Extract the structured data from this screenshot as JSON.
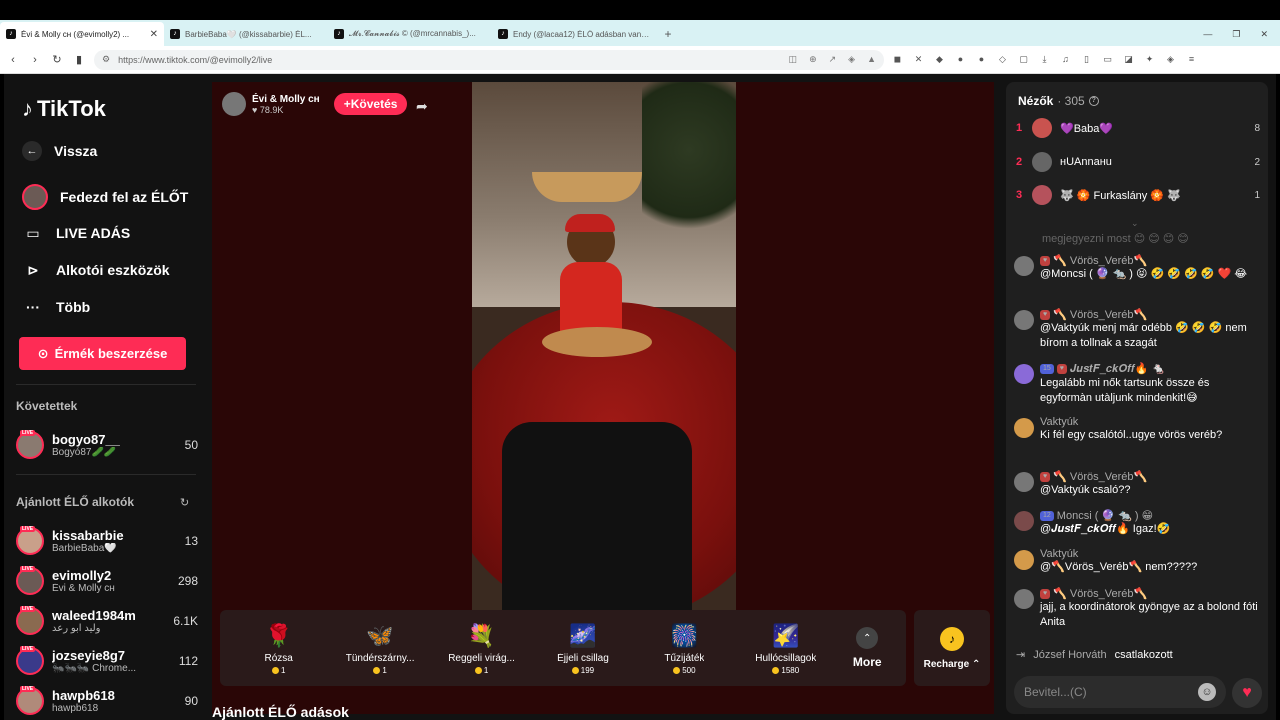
{
  "browser": {
    "tabs": [
      {
        "title": "Évi & Molly ᴄʜ (@evimolly2) ..."
      },
      {
        "title": "BarbieBaba🤍 (@kissabarbie) ÉL..."
      },
      {
        "title": "𝓜𝓻.𝓒𝓪𝓷𝓷𝓪𝓫𝓲𝓼 © (@mrcannabis_)..."
      },
      {
        "title": "Endy (@lacaa12) ÉLŐ adásban van – ..."
      }
    ],
    "url": "https://www.tiktok.com/@evimolly2/live"
  },
  "sidebar": {
    "logo": "TikTok",
    "back": "Vissza",
    "nav": [
      {
        "label": "Fedezd fel az ÉLŐT"
      },
      {
        "label": "LIVE ADÁS"
      },
      {
        "label": "Alkotói eszközök"
      },
      {
        "label": "Több"
      }
    ],
    "coins_button": "Érmék beszerzése",
    "following_title": "Követettek",
    "following": [
      {
        "user": "bogyo87__",
        "name": "Bogyó87🥒🥒",
        "count": "50"
      }
    ],
    "suggested_title": "Ajánlott ÉLŐ alkotók",
    "suggested": [
      {
        "user": "kissabarbie",
        "name": "BarbieBaba🤍",
        "count": "13"
      },
      {
        "user": "evimolly2",
        "name": "Évi & Molly ᴄʜ",
        "count": "298"
      },
      {
        "user": "waleed1984m",
        "name": "وليد ابو رعد",
        "count": "6.1K"
      },
      {
        "user": "jozseyie8g7",
        "name": "🐜🐜🐜 Chrome...",
        "count": "112"
      },
      {
        "user": "hawpb618",
        "name": "hawpb618",
        "count": "90"
      }
    ],
    "live_badge": "LIVE"
  },
  "stream": {
    "name": "Évi & Molly ᴄʜ",
    "likes": "78.9K",
    "follow": "+Követés"
  },
  "gifts": [
    {
      "name": "Rózsa",
      "price": "1",
      "icon": "🌹"
    },
    {
      "name": "Tündérszárny...",
      "price": "1",
      "icon": "🦋"
    },
    {
      "name": "Reggeli virág...",
      "price": "1",
      "icon": "💐"
    },
    {
      "name": "Éjjeli csillag",
      "price": "199",
      "icon": "🌌"
    },
    {
      "name": "Tűzijáték",
      "price": "500",
      "icon": "🎆"
    },
    {
      "name": "Hullócsillagok",
      "price": "1580",
      "icon": "🌠"
    }
  ],
  "more_label": "More",
  "recharge_label": "Recharge ⌃",
  "section_heading": "Ajánlott ÉLŐ adások",
  "panel": {
    "viewers_label": "Nézők",
    "viewers_count": "· 305",
    "ranking": [
      {
        "rank": "1",
        "name": "💜Baba💜",
        "score": "8",
        "color": "#c9534f"
      },
      {
        "rank": "2",
        "name": "нUAnnaнu",
        "score": "2",
        "color": "#666"
      },
      {
        "rank": "3",
        "name": "🐺 🏵️ Furkaslány 🏵️ 🐺",
        "score": "1",
        "color": "#b5525c"
      }
    ],
    "faded_text": "megjegyezni most 😊 😊 😊 😊",
    "messages": [
      {
        "user": "🪓 Vörös_Veréb🪓",
        "badges": [
          "♥"
        ],
        "text": "@Moncsi ( 🔮 🐀 ) 😝 🤣 🤣 🤣 🤣 ❤️ 😂",
        "avatar": "#777"
      },
      {
        "user": "🪓 Vörös_Veréb🪓",
        "badges": [
          "♥"
        ],
        "text": "@Vaktyúk menj már odébb 🤣 🤣 🤣 nem bírom a tollnak a szagát",
        "avatar": "#777"
      },
      {
        "user": "𝑱𝒖𝒔𝒕𝑭_𝒄𝒌𝑶𝒇𝒇🔥 🐁",
        "badges": [
          "15",
          "♥"
        ],
        "text": "Legalább mi nők tartsunk össze és egyformàn utàljunk mindenkit!😅",
        "avatar": "#8a6ad8"
      },
      {
        "user": "Vaktyúk",
        "badges": [],
        "text": "Ki fél egy csalótól..ugye vörös veréb?",
        "avatar": "#d49a4a"
      },
      {
        "user": "🪓 Vörös_Veréb🪓",
        "badges": [
          "♥"
        ],
        "text": "@Vaktyúk csaló??",
        "avatar": "#777"
      },
      {
        "user": "Moncsi ( 🔮 🐀 ) 😁",
        "badges": [
          "12"
        ],
        "text": "@𝑱𝒖𝒔𝒕𝑭_𝒄𝒌𝑶𝒇𝒇🔥 Igaz!🤣",
        "avatar": "#7a4a4a"
      },
      {
        "user": "Vaktyúk",
        "badges": [],
        "text": "@🪓Vörös_Veréb🪓 nem?????",
        "avatar": "#d49a4a"
      },
      {
        "user": "🪓 Vörös_Veréb🪓",
        "badges": [
          "♥"
        ],
        "text": "jajj, a koordinátorok gyöngye az a bolond fóti Anita",
        "avatar": "#777"
      }
    ],
    "join_user": "József Horváth",
    "join_text": "csatlakozott",
    "input_placeholder": "Bevitel...(C)"
  },
  "colors": {
    "accent": "#fe2c55",
    "coin": "#f8c31f"
  }
}
